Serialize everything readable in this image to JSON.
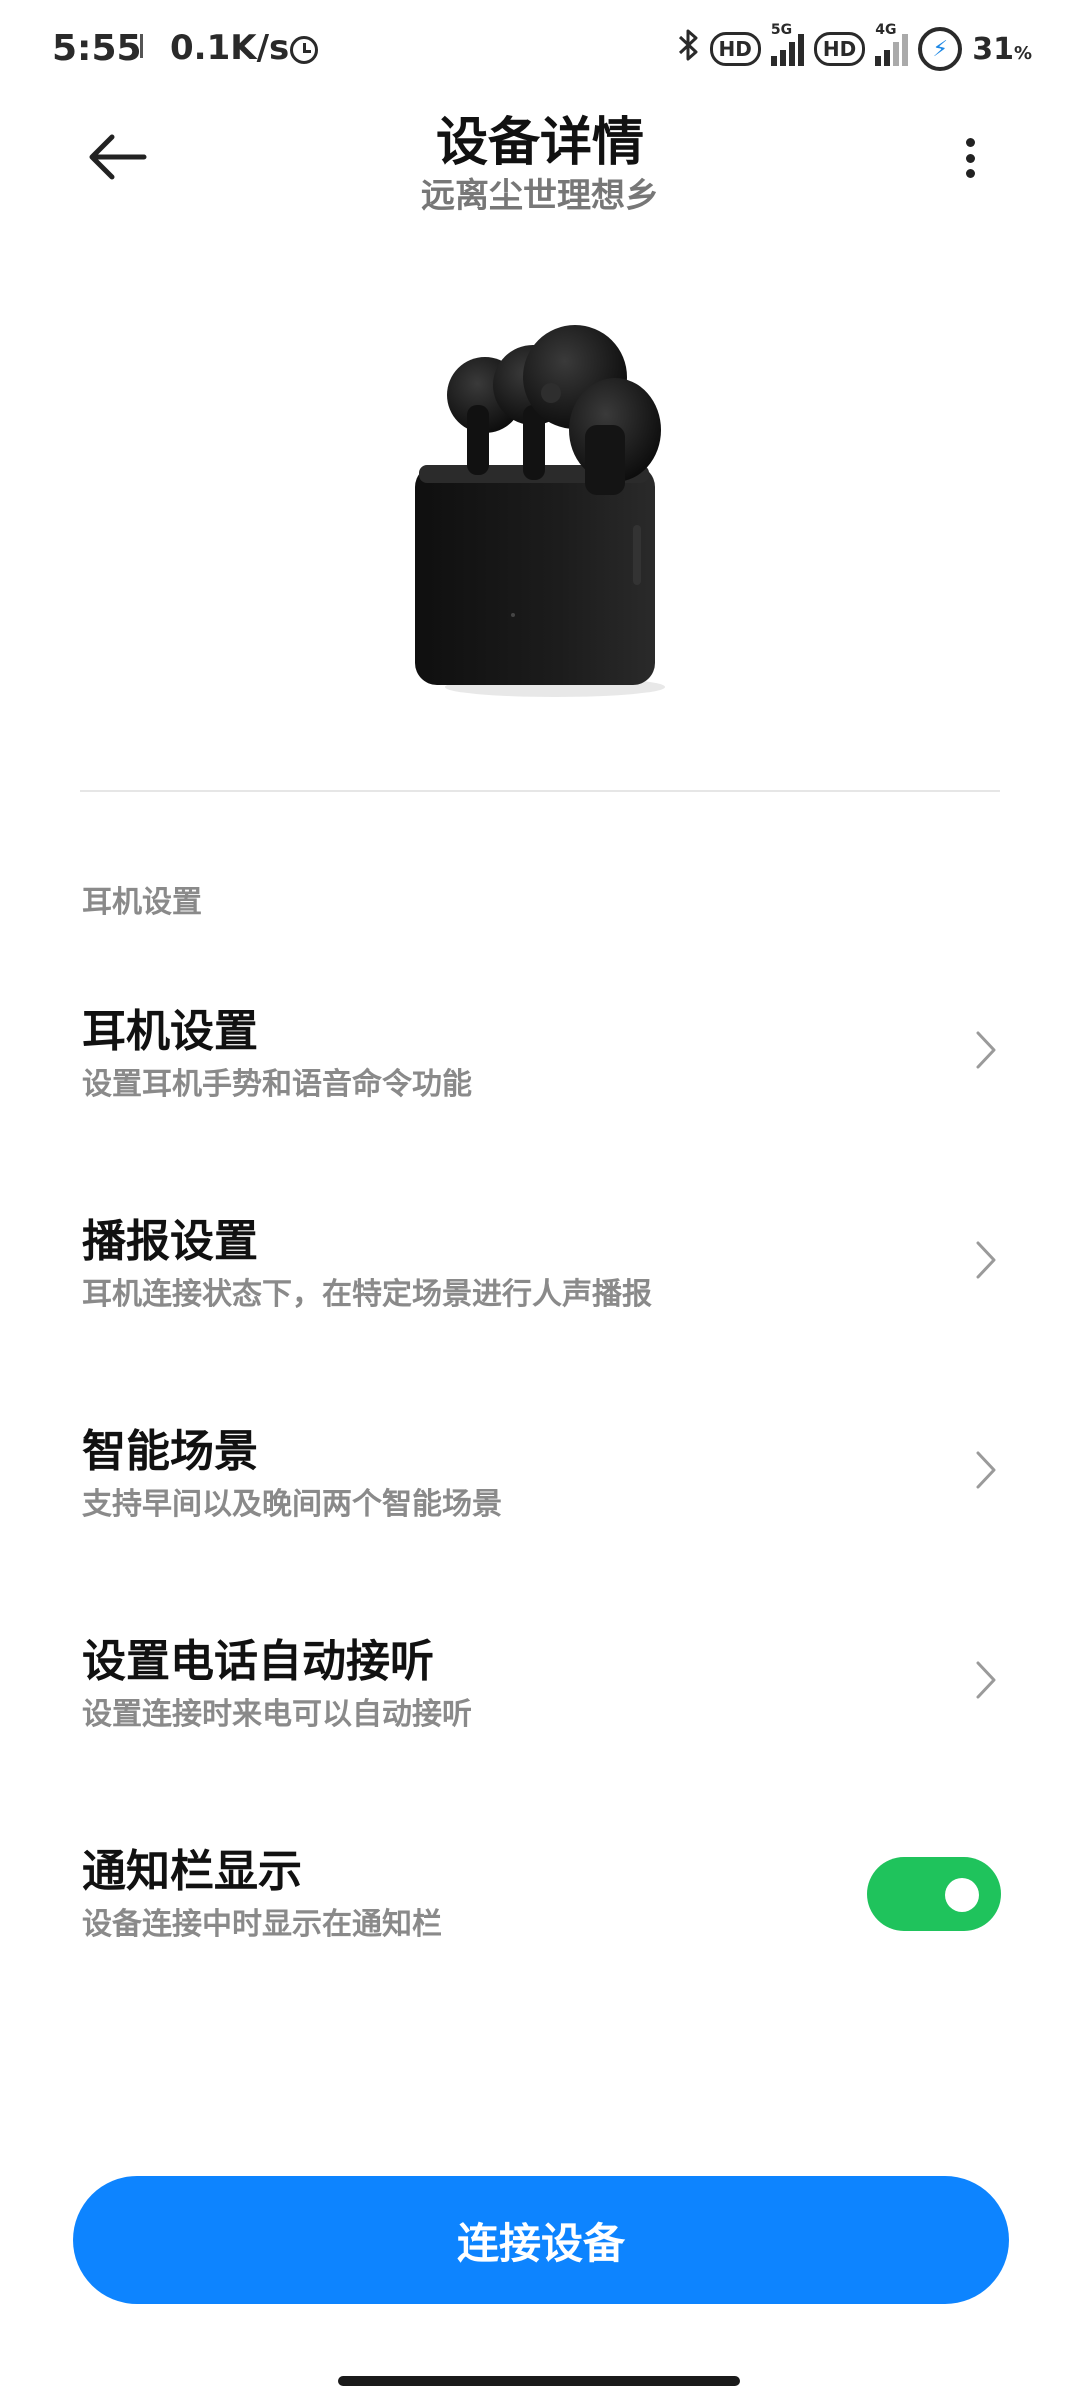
{
  "status_bar": {
    "time": "5:55",
    "speed": "0.1K/s",
    "network_5g": "5G",
    "network_4g": "4G",
    "hd1": "HD",
    "hd2": "HD",
    "battery_percent": "31",
    "battery_unit": "%"
  },
  "header": {
    "title": "设备详情",
    "subtitle": "远离尘世理想乡"
  },
  "section": {
    "label": "耳机设置"
  },
  "rows": [
    {
      "title": "耳机设置",
      "subtitle": "设置耳机手势和语音命令功能"
    },
    {
      "title": "播报设置",
      "subtitle": "耳机连接状态下，在特定场景进行人声播报"
    },
    {
      "title": "智能场景",
      "subtitle": "支持早间以及晚间两个智能场景"
    },
    {
      "title": "设置电话自动接听",
      "subtitle": "设置连接时来电可以自动接听"
    },
    {
      "title": "通知栏显示",
      "subtitle": "设备连接中时显示在通知栏",
      "toggle_on": true
    }
  ],
  "connect_button": {
    "label": "连接设备"
  },
  "colors": {
    "accent_blue": "#0d84ff",
    "toggle_green": "#1fc35c",
    "secondary_text": "#8a8a8a"
  },
  "icons": {
    "back": "arrow-left-icon",
    "more": "more-vertical-icon",
    "chevron": "chevron-right-icon",
    "bluetooth": "bluetooth-icon",
    "clock": "clock-icon",
    "battery": "battery-charging-icon"
  }
}
